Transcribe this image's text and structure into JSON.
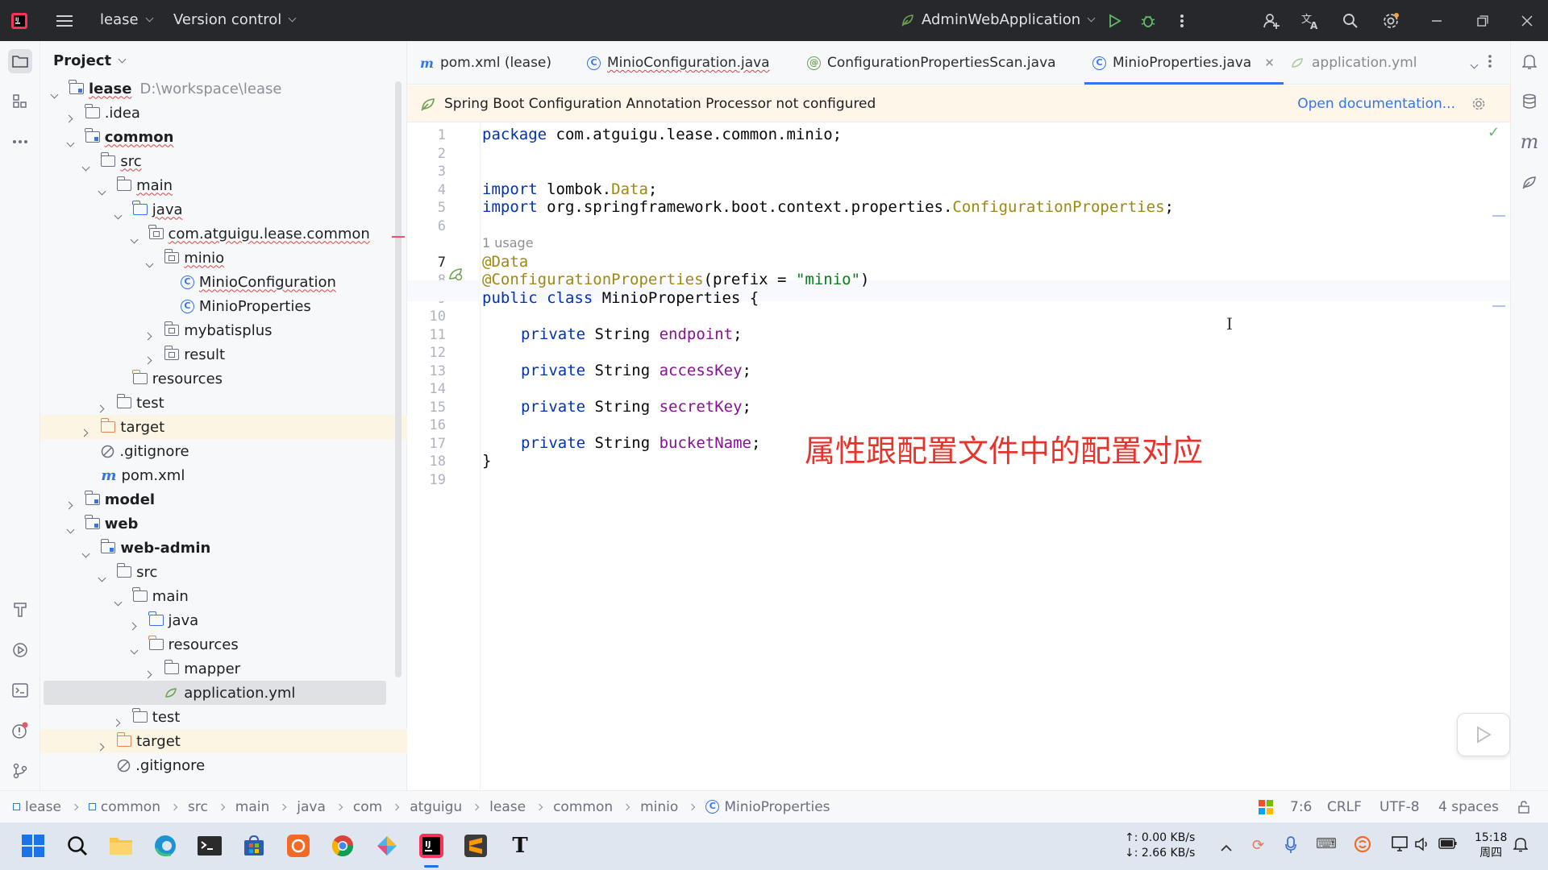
{
  "titlebar": {
    "project_name": "lease",
    "vcs_label": "Version control",
    "run_config": "AdminWebApplication"
  },
  "project_panel": {
    "title": "Project",
    "tree": [
      {
        "label": "lease",
        "suffix": "D:\\workspace\\lease",
        "depth": 0,
        "arrow": "down",
        "icon": "module-folder",
        "bold": true,
        "wavy": true
      },
      {
        "label": ".idea",
        "depth": 1,
        "arrow": "right",
        "icon": "folder"
      },
      {
        "label": "common",
        "depth": 1,
        "arrow": "down",
        "icon": "module-folder",
        "bold": true,
        "wavy": true
      },
      {
        "label": "src",
        "depth": 2,
        "arrow": "down",
        "icon": "folder",
        "wavy": true
      },
      {
        "label": "main",
        "depth": 3,
        "arrow": "down",
        "icon": "folder",
        "wavy": true
      },
      {
        "label": "java",
        "depth": 4,
        "arrow": "down",
        "icon": "source-folder",
        "wavy": true
      },
      {
        "label": "com.atguigu.lease.common",
        "depth": 5,
        "arrow": "down",
        "icon": "package",
        "wavy": true
      },
      {
        "label": "minio",
        "depth": 6,
        "arrow": "down",
        "icon": "package",
        "wavy": true
      },
      {
        "label": "MinioConfiguration",
        "depth": 7,
        "arrow": "none",
        "icon": "class",
        "wavy": true
      },
      {
        "label": "MinioProperties",
        "depth": 7,
        "arrow": "none",
        "icon": "class"
      },
      {
        "label": "mybatisplus",
        "depth": 6,
        "arrow": "right",
        "icon": "package"
      },
      {
        "label": "result",
        "depth": 6,
        "arrow": "right",
        "icon": "package"
      },
      {
        "label": "resources",
        "depth": 4,
        "arrow": "none",
        "icon": "resources-folder"
      },
      {
        "label": "test",
        "depth": 3,
        "arrow": "right",
        "icon": "folder"
      },
      {
        "label": "target",
        "depth": 2,
        "arrow": "right",
        "icon": "excluded-folder",
        "highlight": "excluded"
      },
      {
        "label": ".gitignore",
        "depth": 2,
        "arrow": "none",
        "icon": "ignore-file"
      },
      {
        "label": "pom.xml",
        "depth": 2,
        "arrow": "none",
        "icon": "maven-file"
      },
      {
        "label": "model",
        "depth": 1,
        "arrow": "right",
        "icon": "module-folder",
        "bold": true
      },
      {
        "label": "web",
        "depth": 1,
        "arrow": "down",
        "icon": "module-folder",
        "bold": true
      },
      {
        "label": "web-admin",
        "depth": 2,
        "arrow": "down",
        "icon": "module-folder",
        "bold": true
      },
      {
        "label": "src",
        "depth": 3,
        "arrow": "down",
        "icon": "folder"
      },
      {
        "label": "main",
        "depth": 4,
        "arrow": "down",
        "icon": "folder"
      },
      {
        "label": "java",
        "depth": 5,
        "arrow": "right",
        "icon": "source-folder"
      },
      {
        "label": "resources",
        "depth": 5,
        "arrow": "down",
        "icon": "resources-folder"
      },
      {
        "label": "mapper",
        "depth": 6,
        "arrow": "right",
        "icon": "folder"
      },
      {
        "label": "application.yml",
        "depth": 6,
        "arrow": "none",
        "icon": "yaml-file",
        "highlight": "selected"
      },
      {
        "label": "test",
        "depth": 4,
        "arrow": "right",
        "icon": "folder"
      },
      {
        "label": "target",
        "depth": 3,
        "arrow": "right",
        "icon": "excluded-folder",
        "highlight": "excluded"
      },
      {
        "label": ".gitignore",
        "depth": 3,
        "arrow": "none",
        "icon": "ignore-file"
      }
    ]
  },
  "tabs": [
    {
      "label": "pom.xml (lease)",
      "icon": "maven-icon"
    },
    {
      "label": "MinioConfiguration.java",
      "icon": "class-icon",
      "wavy": true
    },
    {
      "label": "ConfigurationPropertiesScan.java",
      "icon": "annotation-icon"
    },
    {
      "label": "MinioProperties.java",
      "icon": "class-icon",
      "active": true
    },
    {
      "label": "application.yml",
      "icon": "yaml-icon"
    }
  ],
  "banner": {
    "message": "Spring Boot Configuration Annotation Processor not configured",
    "link": "Open documentation..."
  },
  "editor": {
    "line_numbers": [
      "1",
      "2",
      "3",
      "4",
      "5",
      "6",
      "7",
      "8",
      "9",
      "10",
      "11",
      "12",
      "13",
      "14",
      "15",
      "16",
      "17",
      "18",
      "19"
    ],
    "usage_hint": "1 usage",
    "lines": {
      "l1": {
        "kw": "package",
        "rest": " com.atguigu.lease.common.minio;"
      },
      "l4": {
        "kw": "import",
        "a": " lombok.",
        "ann": "Data",
        "b": ";"
      },
      "l5": {
        "kw": "import",
        "a": " org.springframework.boot.context.properties.",
        "ann": "ConfigurationProperties",
        "b": ";"
      },
      "l7": {
        "ann": "@Data"
      },
      "l8": {
        "ann": "@ConfigurationProperties",
        "a": "(prefix = ",
        "str": "\"minio\"",
        "b": ")"
      },
      "l9": {
        "kw1": "public",
        "kw2": "class",
        "rest": " MinioProperties {"
      },
      "l11": {
        "kw": "private",
        "type": " String ",
        "field": "endpoint",
        "end": ";"
      },
      "l13": {
        "kw": "private",
        "type": " String ",
        "field": "accessKey",
        "end": ";"
      },
      "l15": {
        "kw": "private",
        "type": " String ",
        "field": "secretKey",
        "end": ";"
      },
      "l17": {
        "kw": "private",
        "type": " String ",
        "field": "bucketName",
        "end": ";"
      },
      "l18": {
        "rest": "}"
      }
    },
    "overlay_caption": "属性跟配置文件中的配置对应"
  },
  "statusbar": {
    "breadcrumbs": [
      "lease",
      "common",
      "src",
      "main",
      "java",
      "com",
      "atguigu",
      "lease",
      "common",
      "minio",
      "MinioProperties"
    ],
    "caret": "7:6",
    "line_sep": "CRLF",
    "encoding": "UTF-8",
    "indent": "4 spaces"
  },
  "taskbar": {
    "net_up": "↑: 0.00 KB/s",
    "net_down": "↓: 2.66 KB/s",
    "time": "15:18",
    "day": "周四"
  }
}
